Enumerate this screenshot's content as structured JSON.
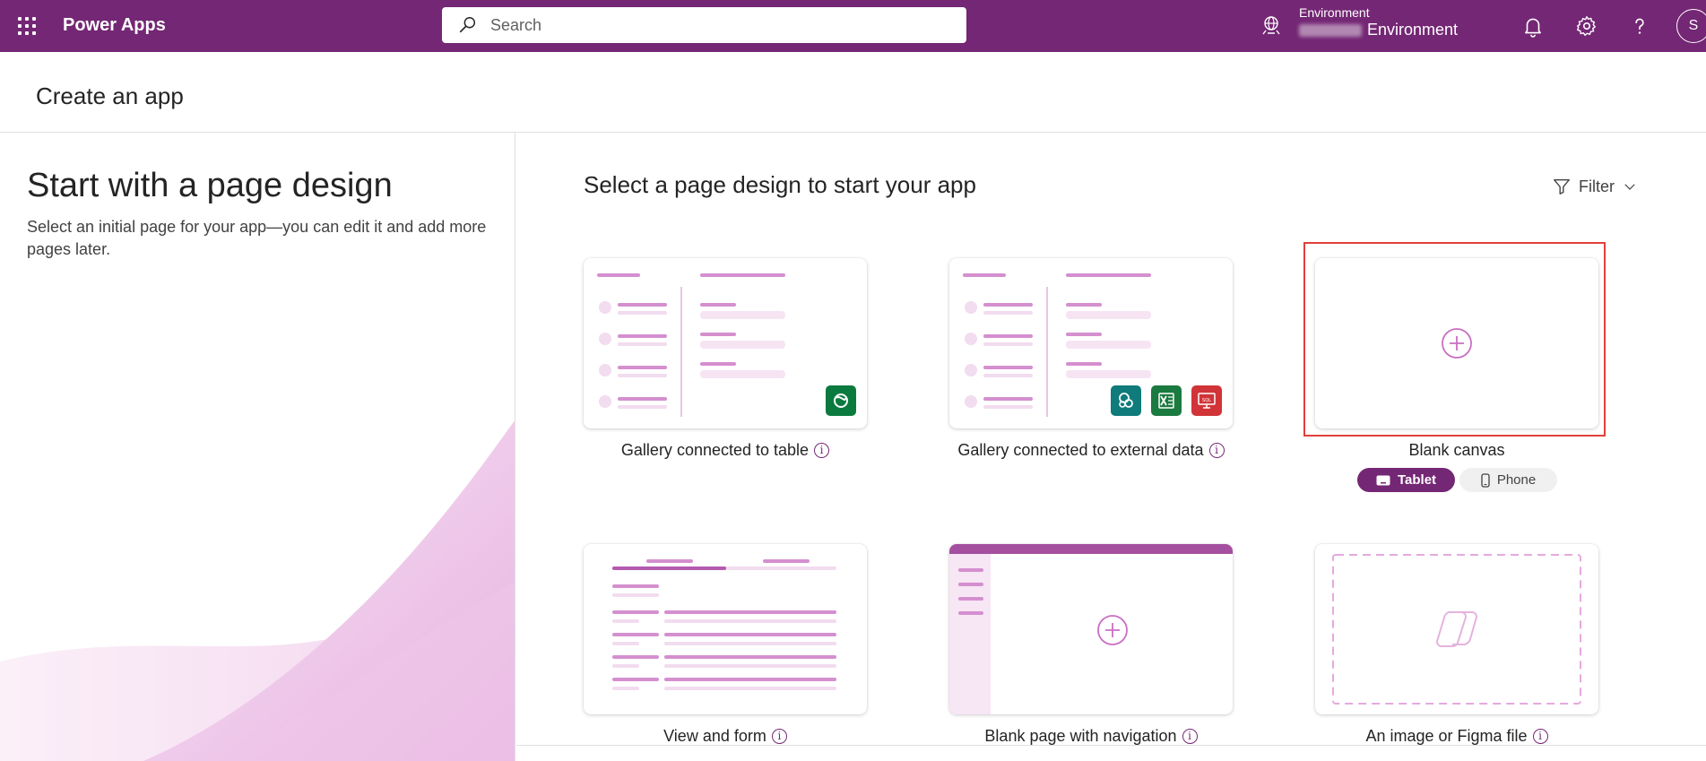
{
  "topbar": {
    "app_name": "Power Apps",
    "search_placeholder": "Search",
    "environment_label": "Environment",
    "environment_name": "Environment",
    "avatar_initial": "S",
    "bg_color": "#742774"
  },
  "page": {
    "title": "Create an app"
  },
  "left": {
    "heading": "Start with a page design",
    "description": "Select an initial page for your app—you can edit it and add more pages later."
  },
  "main": {
    "heading": "Select a page design to start your app",
    "filter_label": "Filter",
    "cards": [
      {
        "label": "Gallery connected to table",
        "icons": [
          "dataverse-icon"
        ]
      },
      {
        "label": "Gallery connected to external data",
        "icons": [
          "sharepoint-icon",
          "excel-icon",
          "sql-icon"
        ]
      },
      {
        "label": "Blank canvas",
        "icons": [
          "plus-icon"
        ],
        "selected": true
      },
      {
        "label": "View and form",
        "icons": []
      },
      {
        "label": "Blank page with navigation",
        "icons": [
          "plus-icon"
        ]
      },
      {
        "label": "An image or Figma file",
        "icons": [
          "copilot-icon"
        ]
      }
    ],
    "form_factor": {
      "tablet": "Tablet",
      "phone": "Phone",
      "selected": "Tablet"
    }
  }
}
